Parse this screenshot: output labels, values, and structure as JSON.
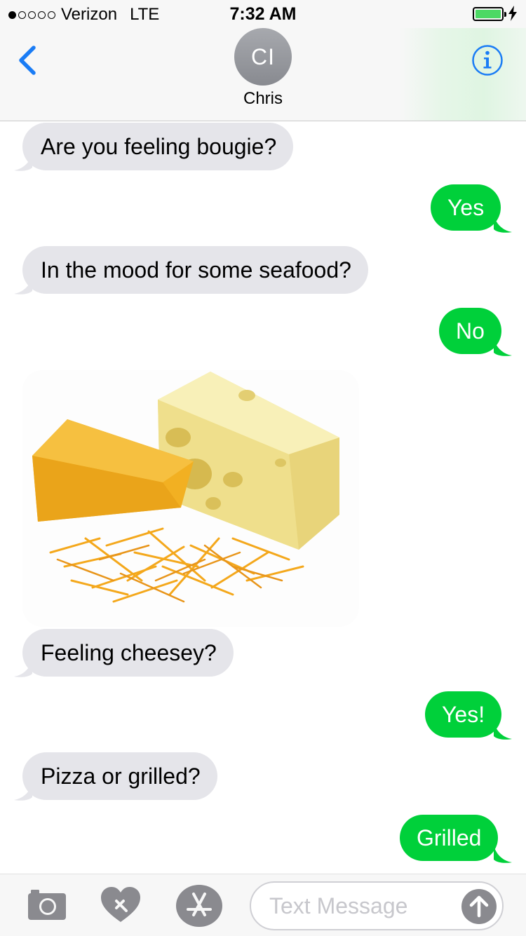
{
  "status_bar": {
    "carrier": "Verizon",
    "network": "LTE",
    "time": "7:32 AM",
    "signal_bars_filled": 1,
    "signal_bars_total": 5,
    "battery_level": 1.0,
    "charging": true
  },
  "header": {
    "back_icon": "chevron-left-icon",
    "avatar_initials": "CI",
    "contact_name": "Chris",
    "info_icon": "info-icon"
  },
  "messages": [
    {
      "sender": "contact",
      "text": "Are you feeling bougie?"
    },
    {
      "sender": "me",
      "text": "Yes"
    },
    {
      "sender": "contact",
      "text": "In the mood for some seafood?"
    },
    {
      "sender": "me",
      "text": "No"
    },
    {
      "sender": "contact",
      "type": "image",
      "image": "cheese-photo"
    },
    {
      "sender": "contact",
      "text": "Feeling cheesey?"
    },
    {
      "sender": "me",
      "text": "Yes!"
    },
    {
      "sender": "contact",
      "text": "Pizza or grilled?"
    },
    {
      "sender": "me",
      "text": "Grilled"
    }
  ],
  "input_bar": {
    "camera_icon": "camera-icon",
    "digital_touch_icon": "heart-icon",
    "apps_icon": "app-store-icon",
    "placeholder": "Text Message",
    "send_icon": "arrow-up-icon"
  },
  "colors": {
    "incoming_bubble": "#e5e5ea",
    "outgoing_bubble": "#00d03a",
    "accent_blue": "#1a7cf5",
    "avatar": "#999ba0"
  }
}
